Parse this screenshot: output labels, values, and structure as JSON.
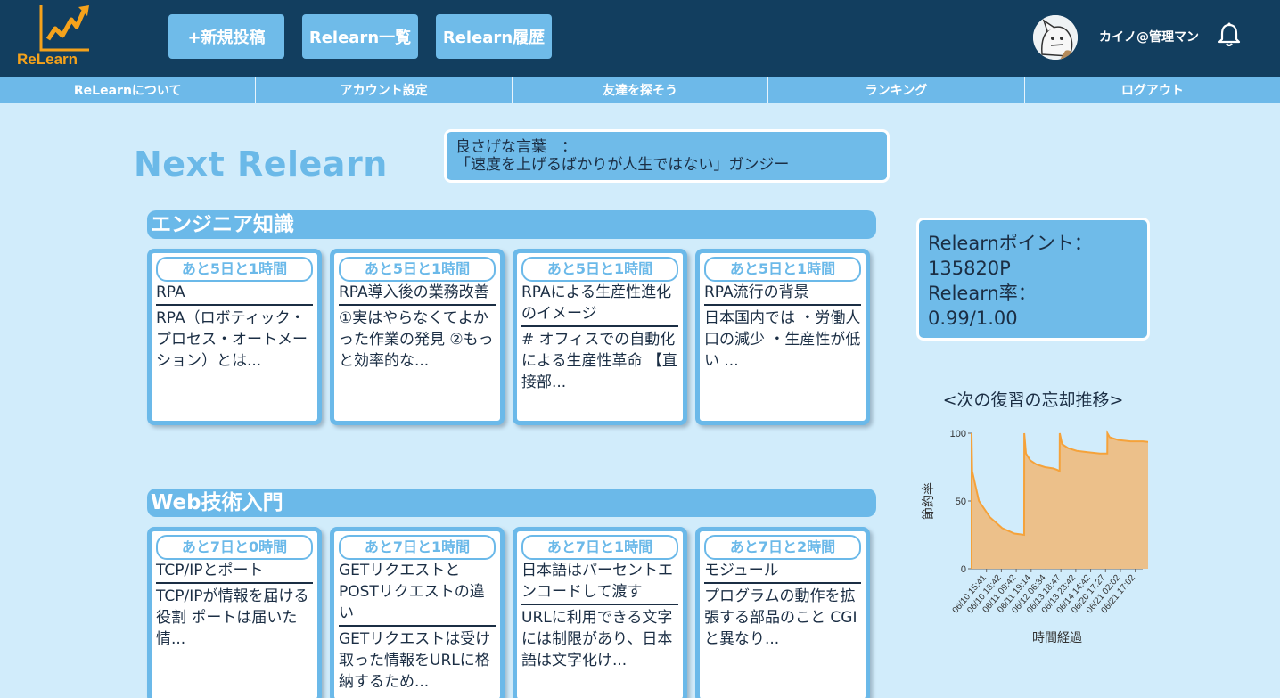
{
  "app": {
    "logo_text": "ReLearn",
    "brand_color": "#f5a21b"
  },
  "header": {
    "buttons": [
      "+新規投稿",
      "Relearn一覧",
      "Relearn履歴"
    ],
    "user_name": "カイノ@管理マン",
    "bell_icon": "bell-icon"
  },
  "subnav": [
    "ReLearnについて",
    "アカウント設定",
    "友達を探そう",
    "ランキング",
    "ログアウト"
  ],
  "page": {
    "title": "Next Relearn",
    "quote_label": "良さげな言葉　：",
    "quote_text": "「速度を上げるばかりが人生ではない」ガンジー"
  },
  "sections": [
    {
      "title": "エンジニア知識",
      "cards": [
        {
          "badge": "あと5日と1時間",
          "title": "RPA",
          "body": "RPA（ロボティック・プロセス・オートメーション）とは..."
        },
        {
          "badge": "あと5日と1時間",
          "title": "RPA導入後の業務改善",
          "body": "①実はやらなくてよかった作業の発見 ②もっと効率的な..."
        },
        {
          "badge": "あと5日と1時間",
          "title": "RPAによる生産性進化のイメージ",
          "body": "# オフィスでの自動化による生産性革命 【直接部..."
        },
        {
          "badge": "あと5日と1時間",
          "title": "RPA流行の背景",
          "body": "日本国内では ・労働人口の減少 ・生産性が低い ..."
        }
      ]
    },
    {
      "title": "Web技術入門",
      "cards": [
        {
          "badge": "あと7日と0時間",
          "title": "TCP/IPとポート",
          "body": "TCP/IPが情報を届ける役割 ポートは届いた情..."
        },
        {
          "badge": "あと7日と1時間",
          "title": "GETリクエストとPOSTリクエストの違い",
          "body": "GETリクエストは受け取った情報をURLに格納するため..."
        },
        {
          "badge": "あと7日と1時間",
          "title": "日本語はパーセントエンコードして渡す",
          "body": "URLに利用できる文字には制限があり、日本語は文字化け..."
        },
        {
          "badge": "あと7日と2時間",
          "title": "モジュール",
          "body": "プログラムの動作を拡張する部品のこと CGIと異なり..."
        }
      ]
    }
  ],
  "stats": {
    "points_label": "Relearnポイント：",
    "points_value": "135820P",
    "rate_label": "Relearn率：",
    "rate_value": "0.99/1.00"
  },
  "chart_data": {
    "type": "area",
    "title": "<次の復習の忘却推移>",
    "xlabel": "時間経過",
    "ylabel": "節約率",
    "ylim": [
      0,
      100
    ],
    "yticks": [
      0,
      50,
      100
    ],
    "color": "#f5a23a",
    "fill": "#ecc08a",
    "x": [
      "06/10 15:41",
      "06/10 18:42",
      "06/11 09:42",
      "06/11 19:14",
      "06/12 06:34",
      "06/13 18:47",
      "06/13 23:42",
      "06/14 14:42",
      "06/20 17:27",
      "06/21 02:02",
      "06/21 17:02"
    ],
    "values": [
      [
        0,
        0
      ],
      [
        0,
        100
      ],
      [
        0.05,
        72
      ],
      [
        0.6,
        50
      ],
      [
        1.5,
        38
      ],
      [
        2.5,
        30
      ],
      [
        3.5,
        26
      ],
      [
        4.3,
        25
      ],
      [
        4.31,
        100
      ],
      [
        4.45,
        85
      ],
      [
        4.8,
        80
      ],
      [
        5.3,
        77
      ],
      [
        6.0,
        75
      ],
      [
        6.7,
        74
      ],
      [
        7.0,
        73
      ],
      [
        7.2,
        72
      ],
      [
        7.21,
        100
      ],
      [
        7.4,
        92
      ],
      [
        7.9,
        89
      ],
      [
        8.6,
        87
      ],
      [
        9.5,
        86
      ],
      [
        10.5,
        85
      ],
      [
        11.1,
        85
      ],
      [
        11.11,
        100
      ],
      [
        11.3,
        97
      ],
      [
        12.0,
        95
      ],
      [
        13.0,
        94
      ],
      [
        14.0,
        94
      ],
      [
        15,
        93
      ]
    ]
  }
}
